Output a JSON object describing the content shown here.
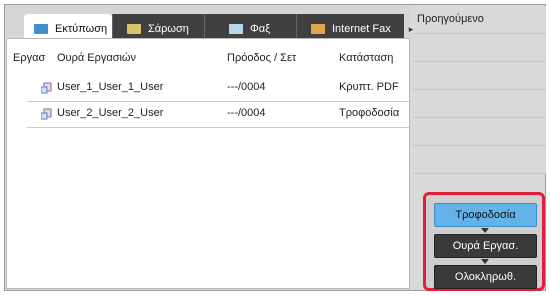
{
  "tabs": [
    {
      "label": "Εκτύπωση",
      "icon": "print-icon"
    },
    {
      "label": "Σάρωση",
      "icon": "scan-icon"
    },
    {
      "label": "Φαξ",
      "icon": "fax-icon"
    },
    {
      "label": "Internet Fax",
      "icon": "internet-fax-icon"
    }
  ],
  "tab_scroll_icon": "▸",
  "table": {
    "headers": {
      "col1": "Εργασ",
      "col2": "Ουρά Εργασιών",
      "col3": "Πρόοδος / Σετ",
      "col4": "Κατάσταση"
    },
    "rows": [
      {
        "user": "User_1_User_1_User",
        "progress": "---/0004",
        "status": "Κρυπτ. PDF"
      },
      {
        "user": "User_2_User_2_User",
        "progress": "---/0004",
        "status": "Τροφοδοσία"
      }
    ]
  },
  "right_panel": {
    "prev_label": "Προηγούμενο"
  },
  "status_buttons": {
    "spool": "Τροφοδοσία",
    "queue": "Ουρά Εργασ.",
    "complete": "Ολοκληρωθ."
  },
  "colors": {
    "active_button": "#63b3e8",
    "highlight_border": "#e0203a",
    "dark_tab": "#404040"
  }
}
